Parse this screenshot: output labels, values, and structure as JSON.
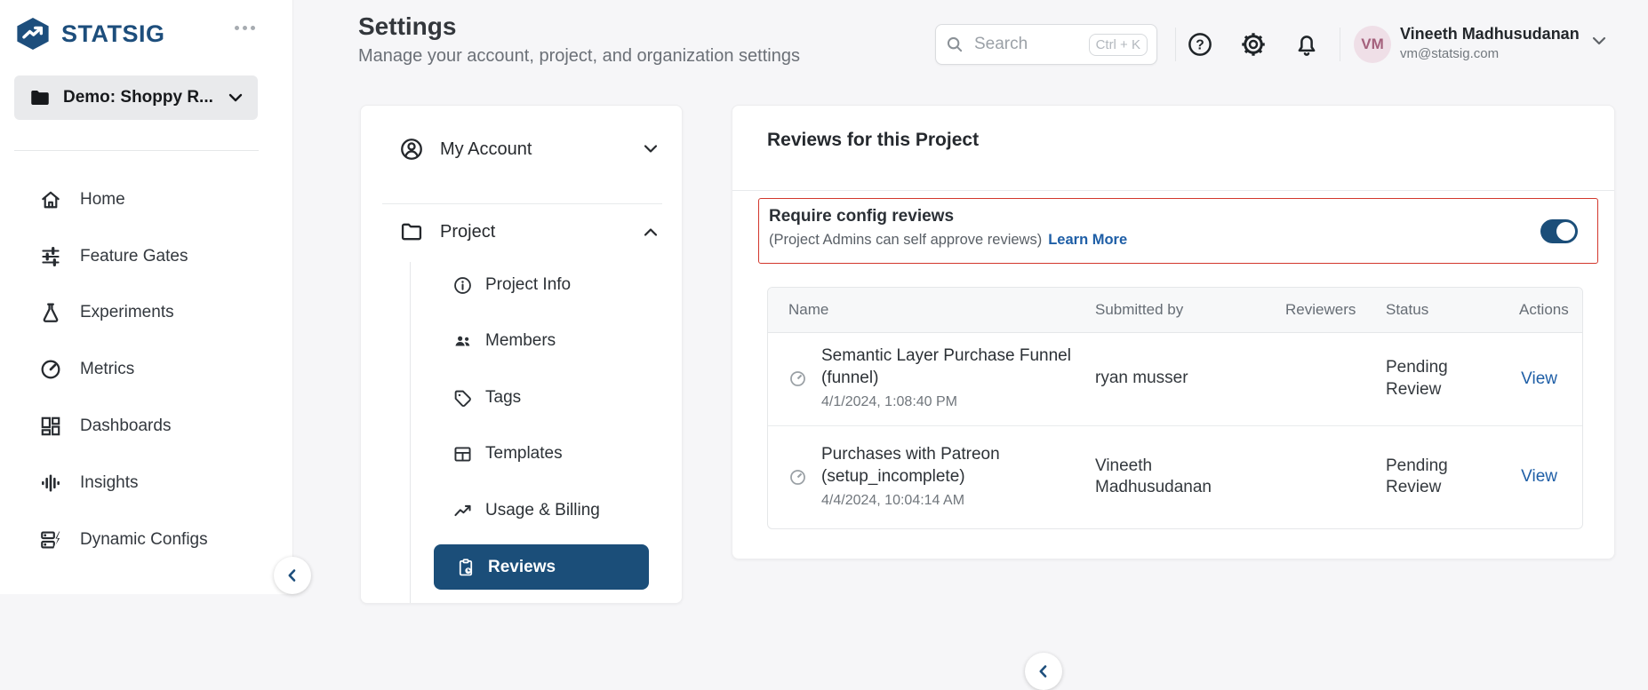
{
  "brand": {
    "name": "STATSIG"
  },
  "project_selector": {
    "label": "Demo: Shoppy R..."
  },
  "sidebar": {
    "items": [
      {
        "label": "Home"
      },
      {
        "label": "Feature Gates"
      },
      {
        "label": "Experiments"
      },
      {
        "label": "Metrics"
      },
      {
        "label": "Dashboards"
      },
      {
        "label": "Insights"
      },
      {
        "label": "Dynamic Configs"
      }
    ]
  },
  "header": {
    "title": "Settings",
    "subtitle": "Manage your account, project, and organization settings",
    "search": {
      "placeholder": "Search",
      "shortcut": "Ctrl + K"
    },
    "user": {
      "initials": "VM",
      "name": "Vineeth Madhusudanan",
      "email": "vm@statsig.com"
    }
  },
  "settings_nav": {
    "sections": [
      {
        "label": "My Account"
      },
      {
        "label": "Project"
      }
    ],
    "project_items": [
      {
        "label": "Project Info"
      },
      {
        "label": "Members"
      },
      {
        "label": "Tags"
      },
      {
        "label": "Templates"
      },
      {
        "label": "Usage & Billing"
      },
      {
        "label": "Reviews",
        "selected": true
      }
    ]
  },
  "panel": {
    "title": "Reviews for this Project",
    "require_reviews": {
      "title": "Require config reviews",
      "subtitle": "(Project Admins can self approve reviews)",
      "link": "Learn More",
      "enabled": true
    },
    "table": {
      "columns": [
        "Name",
        "Submitted by",
        "Reviewers",
        "Status",
        "Actions"
      ],
      "rows": [
        {
          "name": "Semantic Layer Purchase Funnel (funnel)",
          "timestamp": "4/1/2024, 1:08:40 PM",
          "submitted_by": "ryan musser",
          "reviewers": "",
          "status": "Pending Review",
          "action": "View"
        },
        {
          "name": "Purchases with Patreon (setup_incomplete)",
          "timestamp": "4/4/2024, 10:04:14 AM",
          "submitted_by": "Vineeth Madhusudanan",
          "reviewers": "",
          "status": "Pending Review",
          "action": "View"
        }
      ]
    }
  },
  "icons": {
    "brand": "statsig-hexagon-arrow",
    "overflow": "ellipsis-dots",
    "project_selector": "folder-filled",
    "collapse": "chevron-left-circle"
  },
  "colors": {
    "brand_navy": "#1b4e79",
    "link_blue": "#1e5ea6",
    "alert_red": "#d2372c",
    "avatar_bg": "#efdfe7",
    "avatar_text": "#a4607c",
    "page_bg": "#f6f6f8"
  }
}
